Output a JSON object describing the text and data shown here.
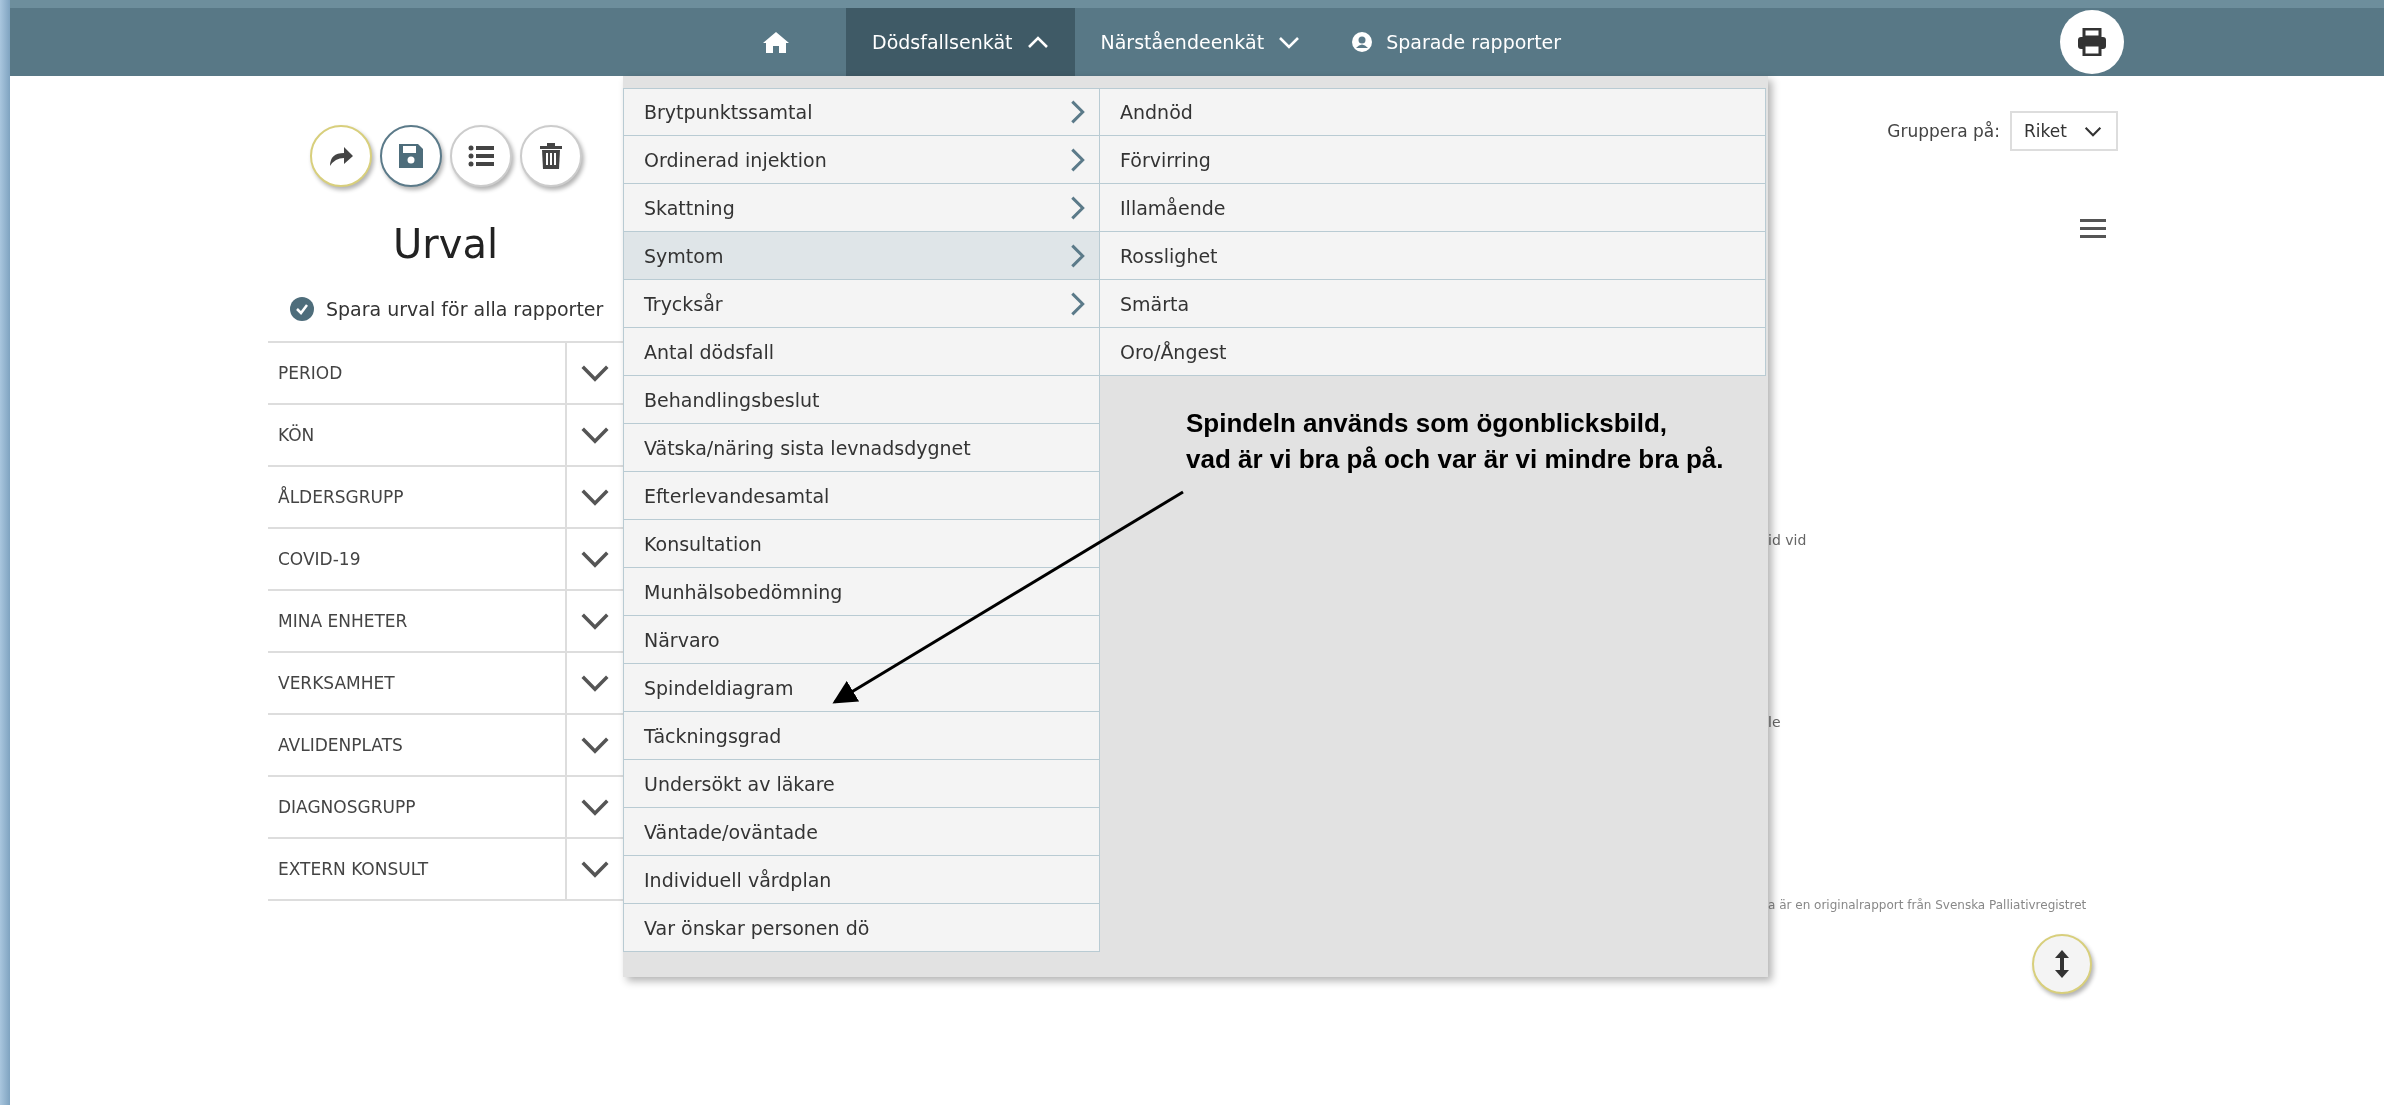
{
  "nav": {
    "items": [
      {
        "kind": "home",
        "selected": false
      },
      {
        "kind": "menu",
        "label": "Dödsfallsenkät",
        "selected": true,
        "expanded": true
      },
      {
        "kind": "menu",
        "label": "Närståendeenkät",
        "selected": false,
        "expanded": false
      },
      {
        "kind": "user",
        "label": "Sparade rapporter",
        "selected": false
      }
    ]
  },
  "sidebar": {
    "title": "Urval",
    "save_all": {
      "label": "Spara urval för alla rapporter",
      "checked": true
    },
    "filters": [
      {
        "label": "PERIOD",
        "expanded": false
      },
      {
        "label": "KÖN",
        "expanded": false
      },
      {
        "label": "ÅLDERSGRUPP",
        "expanded": false
      },
      {
        "label": "COVID-19",
        "expanded": false
      },
      {
        "label": "MINA ENHETER",
        "expanded": false
      },
      {
        "label": "VERKSAMHET",
        "expanded": false
      },
      {
        "label": "AVLIDENPLATS",
        "expanded": false
      },
      {
        "label": "DIAGNOSGRUPP",
        "expanded": false
      },
      {
        "label": "EXTERN KONSULT",
        "expanded": false
      }
    ]
  },
  "dropdown": {
    "items": [
      {
        "label": "Brytpunktssamtal",
        "has_submenu": true,
        "selected": false
      },
      {
        "label": "Ordinerad injektion",
        "has_submenu": true,
        "selected": false
      },
      {
        "label": "Skattning",
        "has_submenu": true,
        "selected": false
      },
      {
        "label": "Symtom",
        "has_submenu": true,
        "selected": true
      },
      {
        "label": "Trycksår",
        "has_submenu": true,
        "selected": false
      },
      {
        "label": "Antal dödsfall",
        "has_submenu": false,
        "selected": false
      },
      {
        "label": "Behandlingsbeslut",
        "has_submenu": false,
        "selected": false
      },
      {
        "label": "Vätska/näring sista levnadsdygnet",
        "has_submenu": false,
        "selected": false
      },
      {
        "label": "Efterlevandesamtal",
        "has_submenu": false,
        "selected": false
      },
      {
        "label": "Konsultation",
        "has_submenu": false,
        "selected": false
      },
      {
        "label": "Munhälsobedömning",
        "has_submenu": false,
        "selected": false
      },
      {
        "label": "Närvaro",
        "has_submenu": false,
        "selected": false
      },
      {
        "label": "Spindeldiagram",
        "has_submenu": false,
        "selected": false
      },
      {
        "label": "Täckningsgrad",
        "has_submenu": false,
        "selected": false
      },
      {
        "label": "Undersökt av läkare",
        "has_submenu": false,
        "selected": false
      },
      {
        "label": "Väntade/oväntade",
        "has_submenu": false,
        "selected": false
      },
      {
        "label": "Individuell vårdplan",
        "has_submenu": false,
        "selected": false
      },
      {
        "label": "Var önskar personen dö",
        "has_submenu": false,
        "selected": false
      }
    ],
    "submenu": [
      "Andnöd",
      "Förvirring",
      "Illamående",
      "Rosslighet",
      "Smärta",
      "Oro/Ångest"
    ]
  },
  "annotation": {
    "text": "Spindeln används som ögonblicksbild,\nvad är vi bra på och var är vi mindre bra på."
  },
  "group_by": {
    "label": "Gruppera på:",
    "value": "Riket"
  },
  "report_fragments": [
    "id vid",
    "le",
    "a är en originalrapport från Svenska Palliativregistret"
  ]
}
